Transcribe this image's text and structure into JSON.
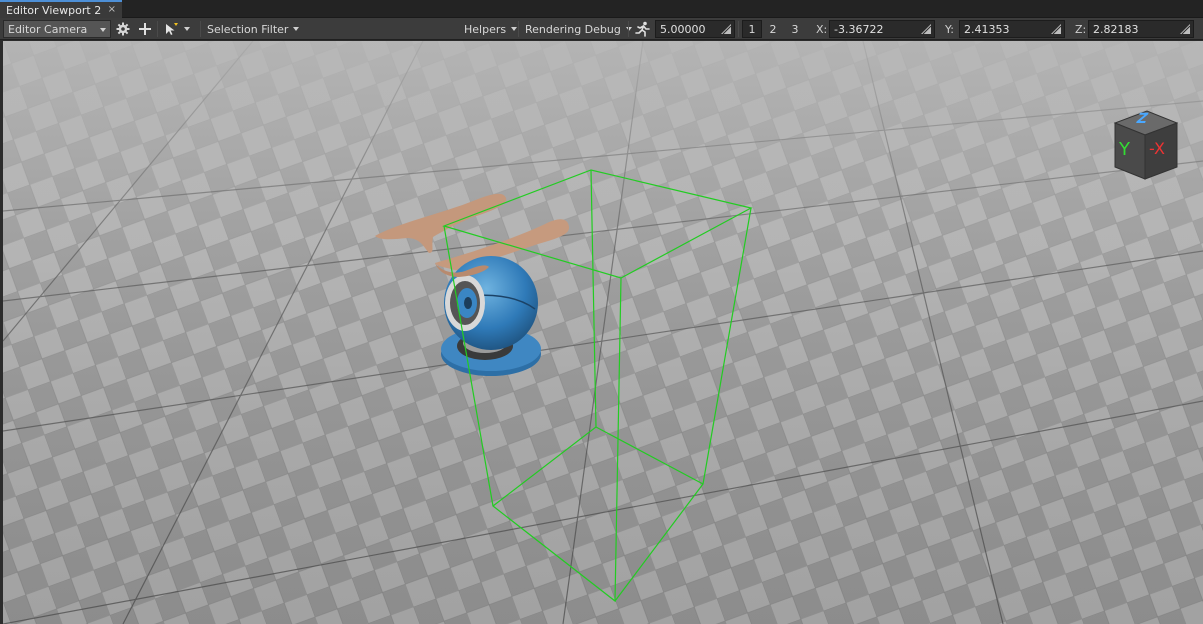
{
  "tab": {
    "title": "Editor Viewport 2",
    "close": "×"
  },
  "toolbar": {
    "camera": "Editor Camera",
    "selection_filter": "Selection Filter",
    "helpers": "Helpers",
    "rendering_debug": "Rendering Debug",
    "speed": "5.00000",
    "layouts": [
      "1",
      "2",
      "3"
    ],
    "x_label": "X:",
    "x_value": "-3.36722",
    "y_label": "Y:",
    "y_value": "2.41353",
    "z_label": "Z:",
    "z_value": "2.82183"
  },
  "navcube": {
    "y": "Y",
    "x": "-X",
    "z": "Z"
  },
  "icons": [
    "gear-icon",
    "plus-icon",
    "cursor-filter-icon",
    "run-speed-icon",
    "spinner-icon"
  ],
  "colors": {
    "selection_box": "#22cc22",
    "accent": "#4d8fd6",
    "floor_light": "#b9b9b9",
    "floor_dark": "#7f7f7f"
  }
}
